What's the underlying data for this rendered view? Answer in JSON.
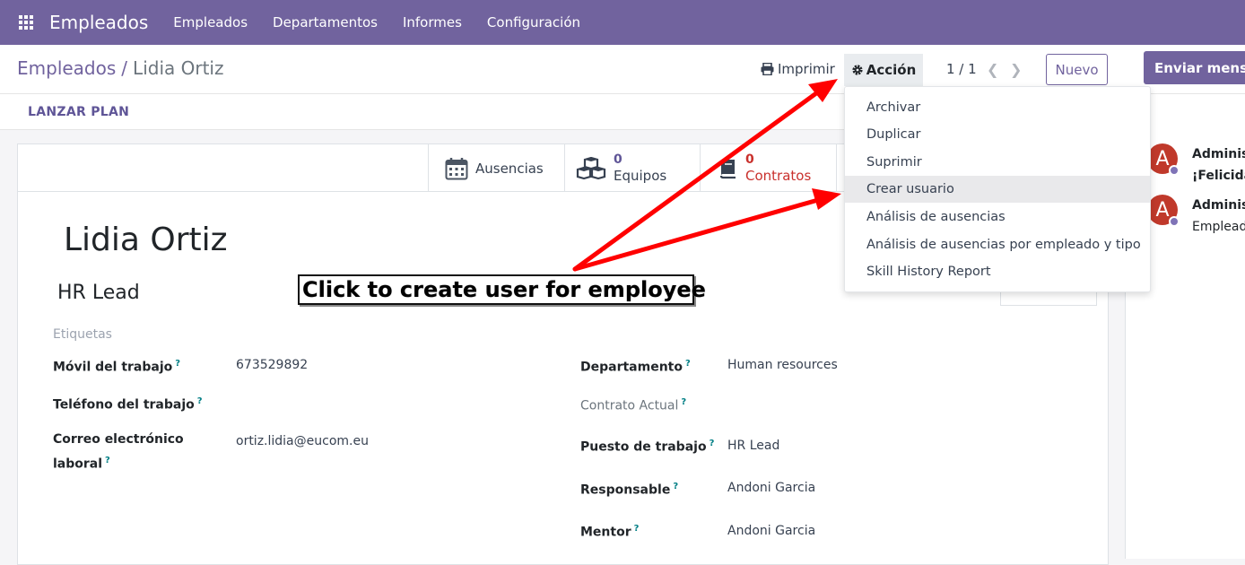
{
  "navbar": {
    "brand": "Empleados",
    "menu": [
      "Empleados",
      "Departamentos",
      "Informes",
      "Configuración"
    ]
  },
  "breadcrumb": {
    "parent": "Empleados",
    "separator": "/",
    "current": "Lidia Ortiz"
  },
  "toolbar": {
    "print_label": "Imprimir",
    "action_label": "Acción",
    "pager": "1 / 1",
    "new_label": "Nuevo",
    "send_message_label": "Enviar mensaje"
  },
  "statusbar": {
    "launch_plan_label": "LANZAR PLAN"
  },
  "smart_buttons": {
    "absences": "Ausencias",
    "teams_count": "0",
    "teams": "Equipos",
    "contracts_count": "0",
    "contracts": "Contratos"
  },
  "employee": {
    "name": "Lidia Ortiz",
    "job_title": "HR Lead",
    "tags_placeholder": "Etiquetas"
  },
  "fields_left": {
    "mobile_label": "Móvil del trabajo",
    "mobile_value": "673529892",
    "phone_label": "Teléfono del trabajo",
    "email_label_1": "Correo electrónico",
    "email_label_2": "laboral",
    "email_value": "ortiz.lidia@eucom.eu"
  },
  "fields_right": {
    "department_label": "Departamento",
    "department_value": "Human resources",
    "contract_label": "Contrato Actual",
    "job_position_label": "Puesto de trabajo",
    "job_position_value": "HR Lead",
    "manager_label": "Responsable",
    "manager_value": "Andoni Garcia",
    "coach_label": "Mentor",
    "coach_value": "Andoni Garcia"
  },
  "action_menu": {
    "items": [
      "Archivar",
      "Duplicar",
      "Suprimir",
      "Crear usuario",
      "Análisis de ausencias",
      "Análisis de ausencias por empleado y tipo",
      "Skill History Report"
    ],
    "highlighted": "Crear usuario"
  },
  "chatter": {
    "messages": [
      {
        "avatar_letter": "A",
        "author": "Administrator",
        "body": "¡Felicidades!"
      },
      {
        "avatar_letter": "A",
        "author": "Administrator",
        "body": "Empleado creado"
      }
    ]
  },
  "annotation": {
    "callout_text": "Click to create user for employee"
  },
  "colors": {
    "brand": "#71639e",
    "danger": "#c9302c",
    "arrow": "#ff0000",
    "avatar": "#c0392b"
  }
}
